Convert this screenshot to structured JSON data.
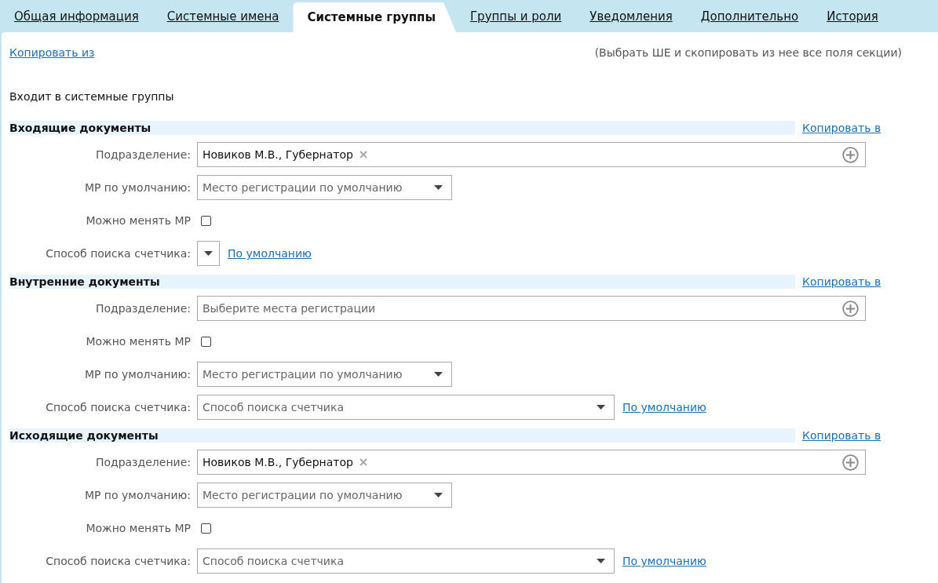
{
  "tabs": [
    {
      "label": "Общая информация",
      "selected": false
    },
    {
      "label": "Системные имена",
      "selected": false
    },
    {
      "label": "Системные группы",
      "selected": true
    },
    {
      "label": "Группы и роли",
      "selected": false
    },
    {
      "label": "Уведомления",
      "selected": false
    },
    {
      "label": "Дополнительно",
      "selected": false
    },
    {
      "label": "История",
      "selected": false
    }
  ],
  "copy_from": "Копировать из",
  "copy_hint": "(Выбрать ШЕ и скопировать из нее все поля секции)",
  "groups_title": "Входит в системные группы",
  "sections": [
    {
      "title": "Входящие документы",
      "copy_link": "Копировать в",
      "rows": [
        {
          "kind": "tags",
          "label": "Подразделение:",
          "tokens": [
            "Новиков М.В., Губернатор"
          ]
        },
        {
          "kind": "select",
          "label": "МР по умолчанию:",
          "placeholder": "Место регистрации по умолчанию"
        },
        {
          "kind": "checkbox",
          "label": "Можно менять МР",
          "checked": false
        },
        {
          "kind": "caret",
          "label": "Способ поиска счетчика:",
          "link": "По умолчанию"
        }
      ]
    },
    {
      "title": "Внутренние документы",
      "copy_link": "Копировать в",
      "rows": [
        {
          "kind": "tags",
          "label": "Подразделение:",
          "placeholder": "Выберите места регистрации"
        },
        {
          "kind": "checkbox",
          "label": "Можно менять МР",
          "checked": false
        },
        {
          "kind": "select",
          "label": "МР по умолчанию:",
          "placeholder": "Место регистрации по умолчанию"
        },
        {
          "kind": "wide-select",
          "label": "Способ поиска счетчика:",
          "placeholder": "Способ поиска счетчика",
          "link": "По умолчанию"
        }
      ]
    },
    {
      "title": "Исходящие документы",
      "copy_link": "Копировать в",
      "rows": [
        {
          "kind": "tags",
          "label": "Подразделение:",
          "tokens": [
            "Новиков М.В., Губернатор"
          ]
        },
        {
          "kind": "select",
          "label": "МР по умолчанию:",
          "placeholder": "Место регистрации по умолчанию"
        },
        {
          "kind": "checkbox",
          "label": "Можно менять МР",
          "checked": false
        },
        {
          "kind": "wide-select",
          "label": "Способ поиска счетчика:",
          "placeholder": "Способ поиска счетчика",
          "link": "По умолчанию"
        }
      ]
    }
  ]
}
